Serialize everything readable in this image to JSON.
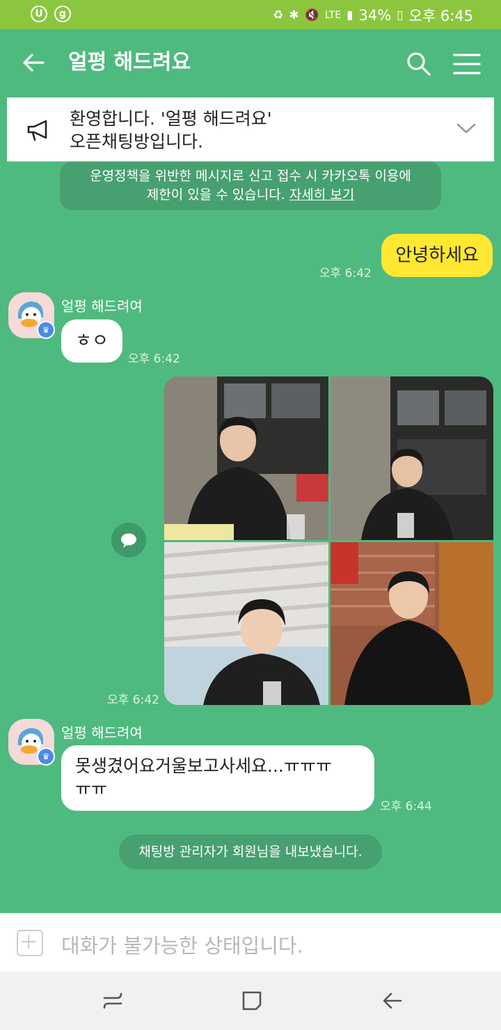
{
  "status_bar": {
    "left_badges": [
      "U",
      "g"
    ],
    "network": "LTE",
    "battery": "34%",
    "time": "오후 6:45"
  },
  "header": {
    "title": "얼평 해드려요"
  },
  "notice": {
    "text_line1": "환영합니다. '얼평 해드려요'",
    "text_line2": "오픈채팅방입니다."
  },
  "policy": {
    "text_line1": "운영정책을 위반한 메시지로 신고 접수 시 카카오톡 이용에",
    "text_line2_prefix": "제한이 있을 수 있습니다.",
    "link": "자세히 보기"
  },
  "messages": {
    "m1": {
      "text": "안녕하세요",
      "time": "오후 6:42"
    },
    "m2": {
      "sender": "얼평 해드려여",
      "text": "ㅎㅇ",
      "time": "오후 6:42"
    },
    "m3": {
      "time": "오후 6:42"
    },
    "m4": {
      "sender": "얼평 해드려여",
      "text_line1": "못생겼어요거울보고사세요...ㅠㅠㅠ",
      "text_line2": "ㅠㅠ",
      "time": "오후 6:44"
    },
    "system": "채팅방 관리자가 회원님을 내보냈습니다."
  },
  "input": {
    "placeholder": "대화가 불가능한 상태입니다."
  },
  "colors": {
    "chat_bg": "#4fba7f",
    "status_bar": "#8cc63f",
    "my_bubble": "#ffe732",
    "crown_badge": "#4a8ae8"
  }
}
